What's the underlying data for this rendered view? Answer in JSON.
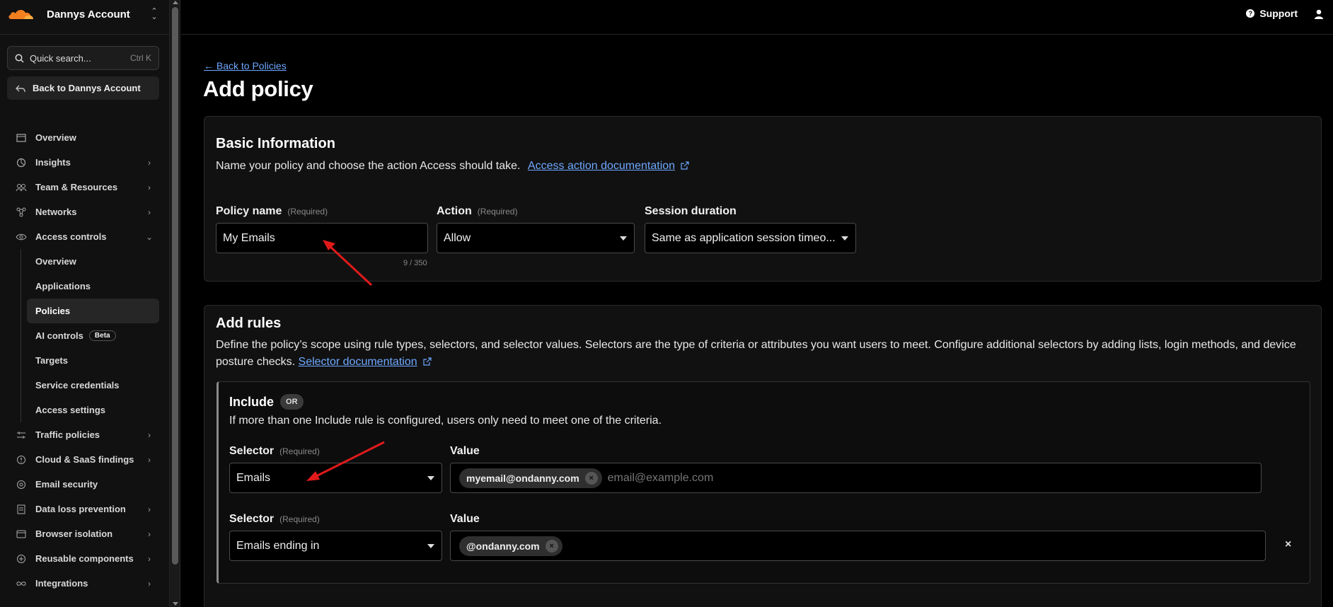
{
  "account": {
    "name": "Dannys Account"
  },
  "sidebar": {
    "search": {
      "label": "Quick search...",
      "shortcut": "Ctrl K"
    },
    "back": {
      "label": "Back to Dannys Account"
    },
    "items": [
      {
        "label": "Overview",
        "icon": "overview-icon"
      },
      {
        "label": "Insights",
        "icon": "insights-icon"
      },
      {
        "label": "Team & Resources",
        "icon": "team-icon"
      },
      {
        "label": "Networks",
        "icon": "networks-icon"
      },
      {
        "label": "Access controls",
        "icon": "access-icon"
      },
      {
        "label": "Traffic policies",
        "icon": "traffic-icon"
      },
      {
        "label": "Cloud & SaaS findings",
        "icon": "cloud-icon"
      },
      {
        "label": "Email security",
        "icon": "email-icon"
      },
      {
        "label": "Data loss prevention",
        "icon": "dlp-icon"
      },
      {
        "label": "Browser isolation",
        "icon": "browser-icon"
      },
      {
        "label": "Reusable components",
        "icon": "components-icon"
      },
      {
        "label": "Integrations",
        "icon": "integrations-icon"
      }
    ],
    "access_sub": [
      {
        "label": "Overview"
      },
      {
        "label": "Applications"
      },
      {
        "label": "Policies"
      },
      {
        "label": "AI controls",
        "badge": "Beta"
      },
      {
        "label": "Targets"
      },
      {
        "label": "Service credentials"
      },
      {
        "label": "Access settings"
      }
    ]
  },
  "topbar": {
    "support": "Support"
  },
  "main": {
    "back_link": "← Back to Policies",
    "title": "Add policy",
    "basic": {
      "heading": "Basic Information",
      "desc": "Name your policy and choose the action Access should take.",
      "doc_link": "Access action documentation",
      "policy_name_label": "Policy name",
      "required": "(Required)",
      "policy_name_value": "My Emails",
      "counter": "9 / 350",
      "action_label": "Action",
      "action_value": "Allow",
      "session_label": "Session duration",
      "session_value": "Same as application session timeo..."
    },
    "rules": {
      "heading": "Add rules",
      "desc": "Define the policy’s scope using rule types, selectors, and selector values. Selectors are the type of criteria or attributes you want users to meet. Configure additional selectors by adding lists, login methods, and device posture checks.",
      "doc_link": "Selector documentation",
      "include_title": "Include",
      "include_badge": "OR",
      "include_desc": "If more than one Include rule is configured, users only need to meet one of the criteria.",
      "selector_label": "Selector",
      "value_label": "Value",
      "required": "(Required)",
      "rows": [
        {
          "selector": "Emails",
          "chip": "myemail@ondanny.com",
          "placeholder": "email@example.com"
        },
        {
          "selector": "Emails ending in",
          "chip": "@ondanny.com",
          "placeholder": ""
        }
      ]
    }
  },
  "colors": {
    "accent_link": "#6ea8ff",
    "brand_orange": "#f38020",
    "annotation_red": "#e01a1a"
  }
}
